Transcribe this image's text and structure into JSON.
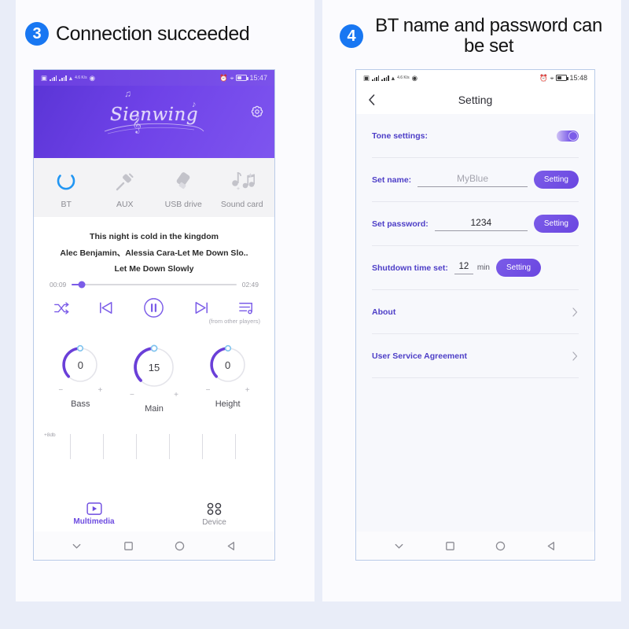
{
  "steps": [
    {
      "number": "3",
      "title": "Connection succeeded"
    },
    {
      "number": "4",
      "title": "BT name and password can be set"
    }
  ],
  "colors": {
    "page_background": "#e9edf8",
    "panel_background": "#fbfbfe",
    "badge_blue": "#1877f2",
    "brand_purple": "#6d4be0",
    "hero_purple_start": "#5b35d6",
    "hero_purple_end": "#7e55ef",
    "accent_label": "#4d3ec7",
    "bt_icon_blue": "#2196f3"
  },
  "phone_left": {
    "status_bar": {
      "time": "15:47",
      "net_speed": "4.6 K/s"
    },
    "hero": {
      "logo_text": "Sienwing",
      "settings_icon": "gear-icon"
    },
    "sources": [
      {
        "id": "bt",
        "label": "BT",
        "icon": "bluetooth-ring-icon",
        "active": true
      },
      {
        "id": "aux",
        "label": "AUX",
        "icon": "aux-plug-icon",
        "active": false
      },
      {
        "id": "usb",
        "label": "USB drive",
        "icon": "usb-drive-icon",
        "active": false
      },
      {
        "id": "soundcard",
        "label": "Sound card",
        "icon": "music-notes-icon",
        "active": false
      }
    ],
    "player": {
      "title": "This night is cold in the kingdom",
      "artist": "Alec Benjamin、Alessia Cara-Let Me Down Slo..",
      "subtitle": "Let Me Down Slowly",
      "elapsed": "00:09",
      "duration": "02:49",
      "progress_percent": 6,
      "note": "(from other players)",
      "controls": [
        {
          "id": "shuffle",
          "icon": "shuffle-icon"
        },
        {
          "id": "previous",
          "icon": "previous-track-icon"
        },
        {
          "id": "play",
          "icon": "pause-circle-icon"
        },
        {
          "id": "next",
          "icon": "next-track-icon"
        },
        {
          "id": "playlist",
          "icon": "playlist-icon"
        }
      ]
    },
    "knobs": [
      {
        "label": "Bass",
        "value": "0",
        "percent": 0,
        "minus": "−",
        "plus": "+"
      },
      {
        "label": "Main",
        "value": "15",
        "percent": 50,
        "minus": "−",
        "plus": "+"
      },
      {
        "label": "Height",
        "value": "0",
        "percent": 0,
        "minus": "−",
        "plus": "+"
      }
    ],
    "equalizer": {
      "db_label": "+8db",
      "band_count": 6
    },
    "tabs": [
      {
        "label": "Multimedia",
        "icon": "media-play-box-icon",
        "active": true
      },
      {
        "label": "Device",
        "icon": "grid-squares-icon",
        "active": false
      }
    ],
    "nav_buttons": [
      "chevron-down-icon",
      "square-icon",
      "circle-icon",
      "triangle-back-icon"
    ]
  },
  "phone_right": {
    "status_bar": {
      "time": "15:48",
      "net_speed": "4.6 K/s"
    },
    "header": {
      "title": "Setting",
      "back_icon": "chevron-left-icon"
    },
    "rows": [
      {
        "id": "tone",
        "label": "Tone settings:",
        "type": "toggle",
        "toggle_on": true
      },
      {
        "id": "name",
        "label": "Set name:",
        "type": "input-button",
        "value": "MyBlue",
        "is_placeholder": true,
        "button": "Setting"
      },
      {
        "id": "password",
        "label": "Set password:",
        "type": "input-button",
        "value": "1234",
        "is_placeholder": false,
        "button": "Setting"
      },
      {
        "id": "shutdown",
        "label": "Shutdown time set:",
        "type": "input-unit-button",
        "value": "12",
        "unit": "min",
        "button": "Setting"
      },
      {
        "id": "about",
        "label": "About",
        "type": "link"
      },
      {
        "id": "terms",
        "label": "User Service Agreement",
        "type": "link"
      }
    ],
    "nav_buttons": [
      "chevron-down-icon",
      "square-icon",
      "circle-icon",
      "triangle-back-icon"
    ]
  }
}
